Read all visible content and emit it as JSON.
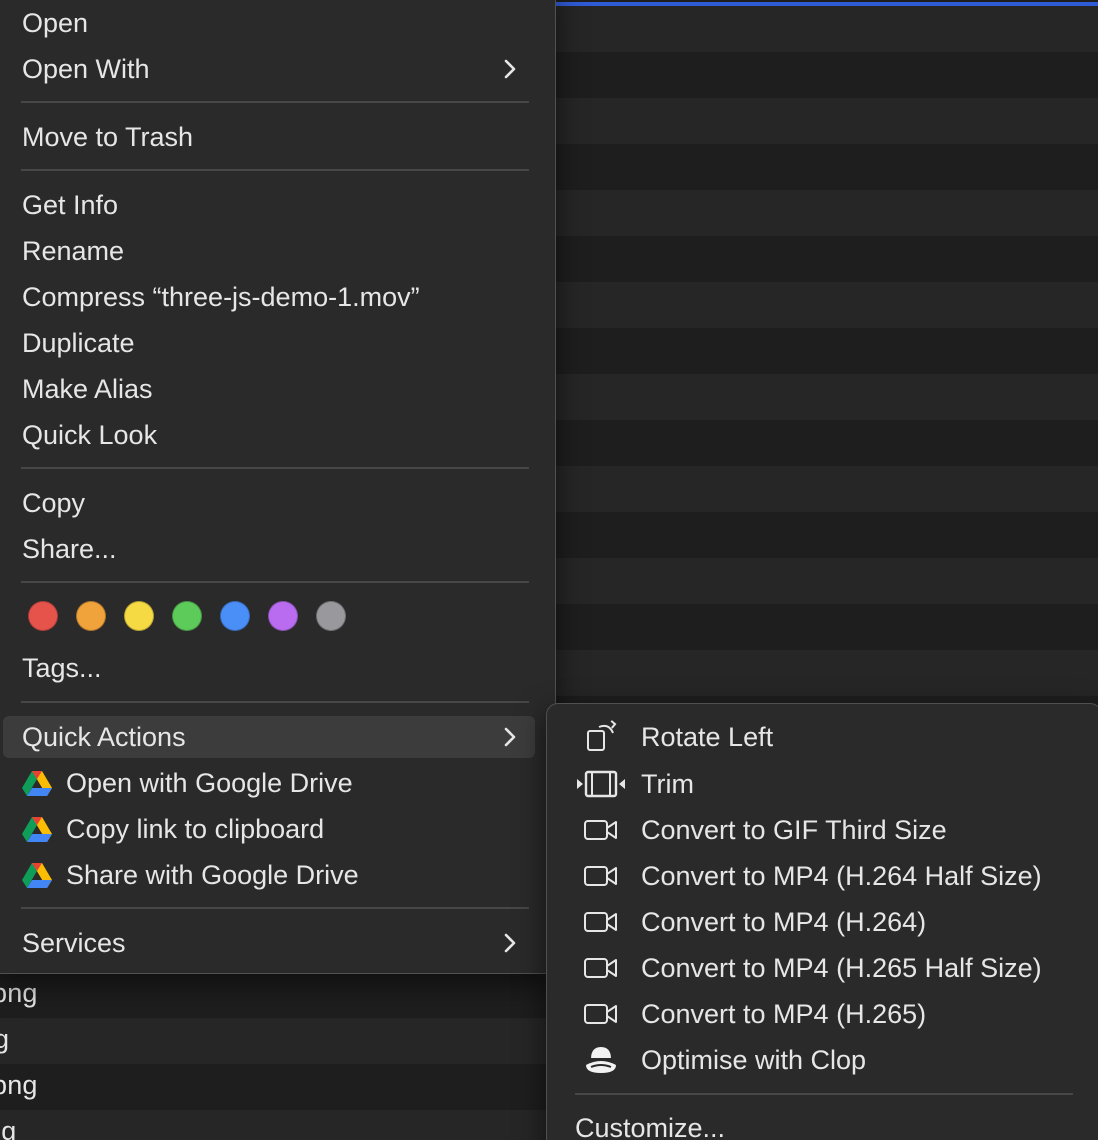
{
  "background": {
    "files": [
      "png",
      "g",
      "png",
      "ng"
    ]
  },
  "colors": {
    "menu_bg": "#2a2a2b",
    "highlight": "#3c3c3d",
    "accent_line": "#2f5bd6"
  },
  "menu": {
    "open": "Open",
    "open_with": "Open With",
    "move_to_trash": "Move to Trash",
    "get_info": "Get Info",
    "rename": "Rename",
    "compress": "Compress “three-js-demo-1.mov”",
    "duplicate": "Duplicate",
    "make_alias": "Make Alias",
    "quick_look": "Quick Look",
    "copy": "Copy",
    "share": "Share...",
    "tags_label": "Tags...",
    "tag_colors": [
      "#e5534b",
      "#f0a23b",
      "#f5da44",
      "#5dcb5a",
      "#4a8ff7",
      "#b96cf0",
      "#98989d"
    ],
    "quick_actions": "Quick Actions",
    "open_google_drive": "Open with Google Drive",
    "copy_link": "Copy link to clipboard",
    "share_google_drive": "Share with Google Drive",
    "services": "Services"
  },
  "submenu": {
    "items": [
      {
        "label": "Rotate Left",
        "icon": "rotate-left-icon"
      },
      {
        "label": "Trim",
        "icon": "trim-icon"
      },
      {
        "label": "Convert to GIF Third Size",
        "icon": "video-camera-icon"
      },
      {
        "label": "Convert to MP4 (H.264 Half Size)",
        "icon": "video-camera-icon"
      },
      {
        "label": "Convert to MP4 (H.264)",
        "icon": "video-camera-icon"
      },
      {
        "label": "Convert to MP4 (H.265 Half Size)",
        "icon": "video-camera-icon"
      },
      {
        "label": "Convert to MP4 (H.265)",
        "icon": "video-camera-icon"
      },
      {
        "label": "Optimise with Clop",
        "icon": "clop-icon"
      }
    ],
    "customize": "Customize..."
  }
}
